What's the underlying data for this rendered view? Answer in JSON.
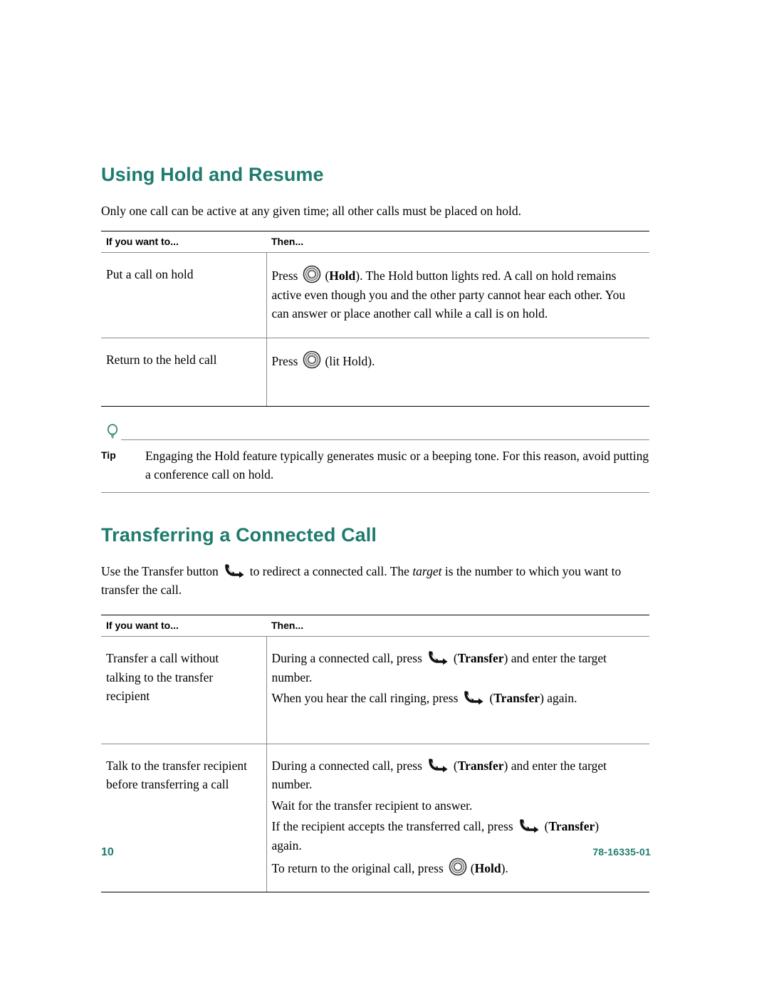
{
  "page": {
    "number": "10",
    "doc_number": "78-16335-01"
  },
  "sections": [
    {
      "title": "Using Hold and Resume",
      "intro": "Only one call can be active at any given time; all other calls must be placed on hold.",
      "table": {
        "headers": [
          "If you want to...",
          "Then..."
        ],
        "rows": [
          {
            "col1": "Put a call on hold",
            "lines": [
              "Press   (Hold). The Hold button lights red. A call on hold remains active even though you and the other party cannot hear each other. You can answer or place another call while a call is on hold."
            ]
          },
          {
            "col1": "Return to the held call",
            "lines": [
              "Press   (lit Hold)."
            ]
          }
        ]
      }
    },
    {
      "title": "Transferring a Connected Call",
      "intro": "Use the Transfer button   to redirect a connected call. The target is the number to which you want to transfer the call.",
      "table": {
        "headers": [
          "If you want to...",
          "Then..."
        ],
        "rows": [
          {
            "col1": "Transfer a call without talking to the transfer recipient",
            "lines": [
              "During a connected call, press   (Transfer) and enter the target number.",
              "When you hear the call ringing, press   (Transfer) again."
            ]
          },
          {
            "col1": "Talk to the transfer recipient before transferring a call",
            "lines": [
              "During a connected call, press   (Transfer) and enter the target number.",
              "Wait for the transfer recipient to answer.",
              "If the recipient accepts the transferred call, press   (Transfer) again.",
              "To return to the original call, press   (Hold)."
            ]
          }
        ]
      }
    }
  ],
  "tip": {
    "label": "Tip",
    "text": "Engaging the Hold feature typically generates music or a beeping tone. For this reason, avoid putting a conference call on hold.",
    "icon": "tip-bulb-icon"
  },
  "colors": {
    "heading": "#1e7b6e",
    "rule": "#8a8a8a",
    "text": "#000000"
  },
  "text_fragments": {
    "press": "Press",
    "hold_label": "Hold",
    "lit_hold": "(lit Hold).",
    "hold_paren_open": "(",
    "hold_rest": "). The Hold button lights red. A call on hold remains active even though you and the other party cannot hear each other. You can answer or place another call while a call is on hold.",
    "use_transfer_1": "Use the Transfer button",
    "use_transfer_2": "to redirect a connected call. The",
    "target_em": "target",
    "use_transfer_3": "is the number to which you want to transfer the call.",
    "during_call": "During a connected call, press",
    "transfer_label": "Transfer",
    "and_enter": ") and enter the target number.",
    "when_ringing": "When you hear the call ringing, press",
    "again_close": ") again.",
    "wait_answer": "Wait for the transfer recipient to answer.",
    "if_accepts": "If the recipient accepts the transferred call, press",
    "again_word": "again.",
    "to_return": "To return to the original call, press",
    "hold_close": ")."
  }
}
